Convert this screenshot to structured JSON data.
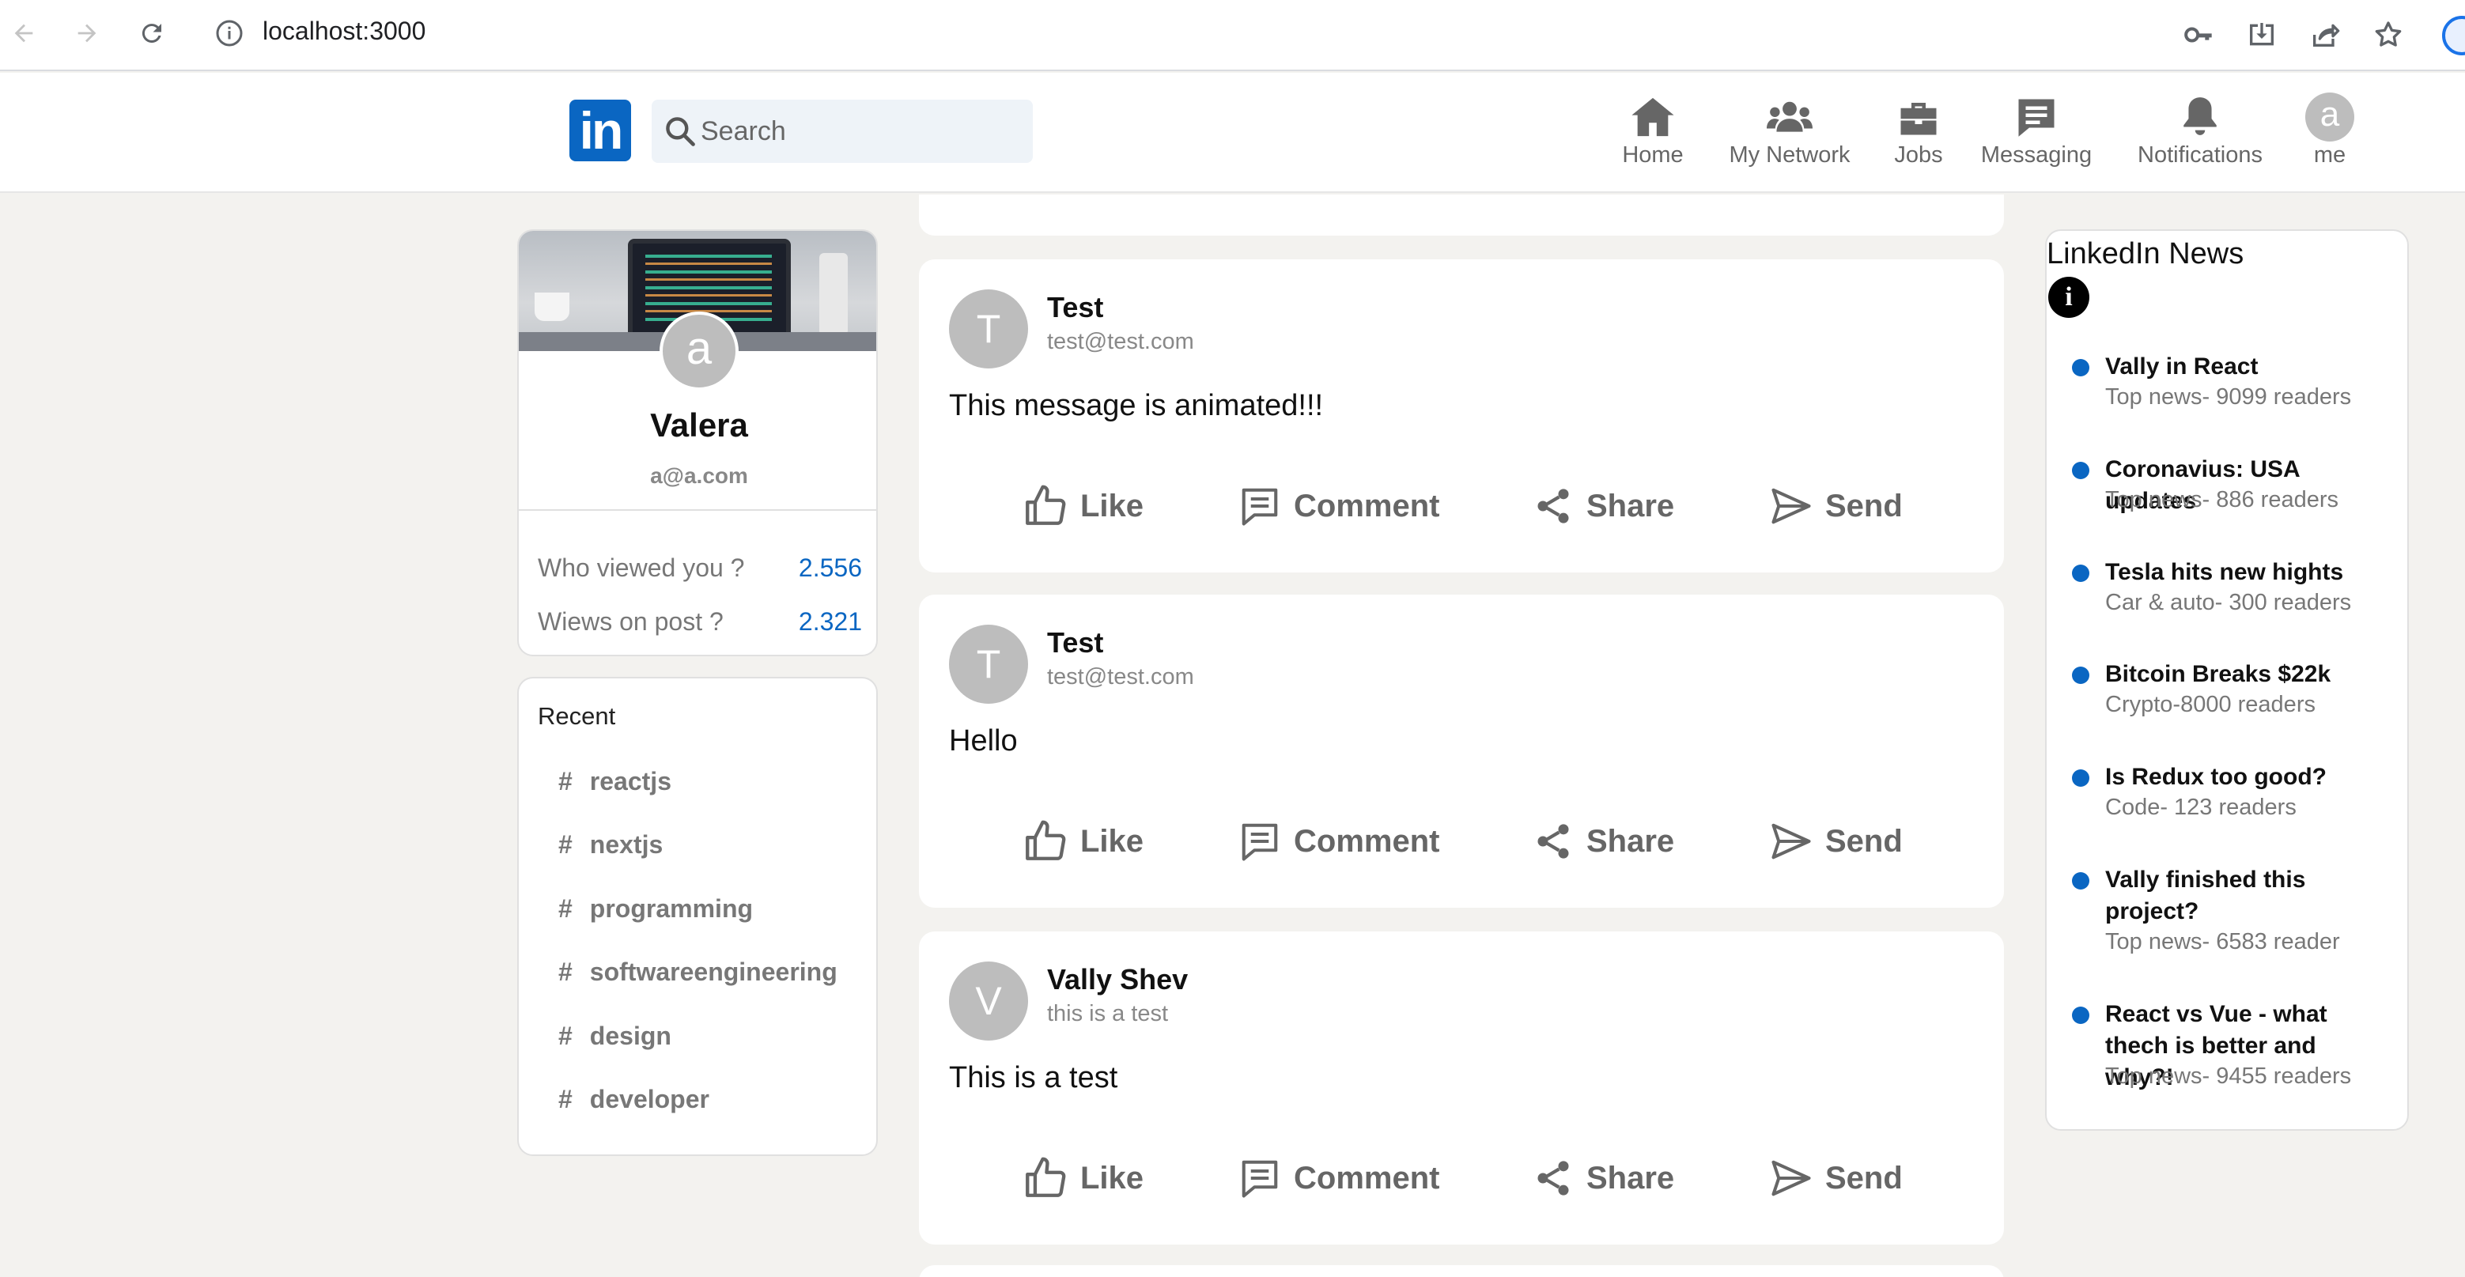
{
  "browser": {
    "url": "localhost:3000"
  },
  "header": {
    "logo_text": "in",
    "search_placeholder": "Search",
    "nav": [
      {
        "label": "Home",
        "icon": "home-icon"
      },
      {
        "label": "My Network",
        "icon": "network-icon"
      },
      {
        "label": "Jobs",
        "icon": "briefcase-icon"
      },
      {
        "label": "Messaging",
        "icon": "message-icon"
      },
      {
        "label": "Notifications",
        "icon": "bell-icon"
      },
      {
        "label": "me",
        "icon": "avatar",
        "avatar_letter": "a"
      }
    ]
  },
  "sidebar": {
    "avatar_letter": "a",
    "name": "Valera",
    "email": "a@a.com",
    "stats": [
      {
        "label": "Who viewed you ?",
        "value": "2.556"
      },
      {
        "label": "Wiews on post ?",
        "value": "2.321"
      }
    ],
    "recent_title": "Recent",
    "recent": [
      "reactjs",
      "nextjs",
      "programming",
      "softwareengineering",
      "design",
      "developer"
    ]
  },
  "feed": {
    "action_labels": [
      "Like",
      "Comment",
      "Share",
      "Send"
    ],
    "posts": [
      {
        "avatar_letter": "T",
        "author": "Test",
        "subtitle": "test@test.com",
        "message": "This message is animated!!!"
      },
      {
        "avatar_letter": "T",
        "author": "Test",
        "subtitle": "test@test.com",
        "message": "Hello"
      },
      {
        "avatar_letter": "V",
        "author": "Vally Shev",
        "subtitle": "this is a test",
        "message": "This is a test"
      }
    ]
  },
  "news": {
    "title": "LinkedIn News",
    "info_glyph": "i",
    "items": [
      {
        "headline": "Vally in React",
        "meta": "Top news- 9099 readers"
      },
      {
        "headline": "Coronavius: USA updates",
        "meta": "Top news- 886 readers"
      },
      {
        "headline": "Tesla hits new hights",
        "meta": "Car & auto- 300 readers"
      },
      {
        "headline": "Bitcoin Breaks $22k",
        "meta": "Crypto-8000 readers"
      },
      {
        "headline": "Is Redux too good?",
        "meta": "Code- 123 readers"
      },
      {
        "headline": "Vally finished this project?",
        "meta": "Top news- 6583 reader"
      },
      {
        "headline": "React vs Vue - what thech is better and why?!",
        "meta": "Top news- 9455 readers"
      }
    ]
  },
  "colors": {
    "brand": "#0a66c2",
    "background": "#f3f2ef",
    "muted": "#666666"
  }
}
